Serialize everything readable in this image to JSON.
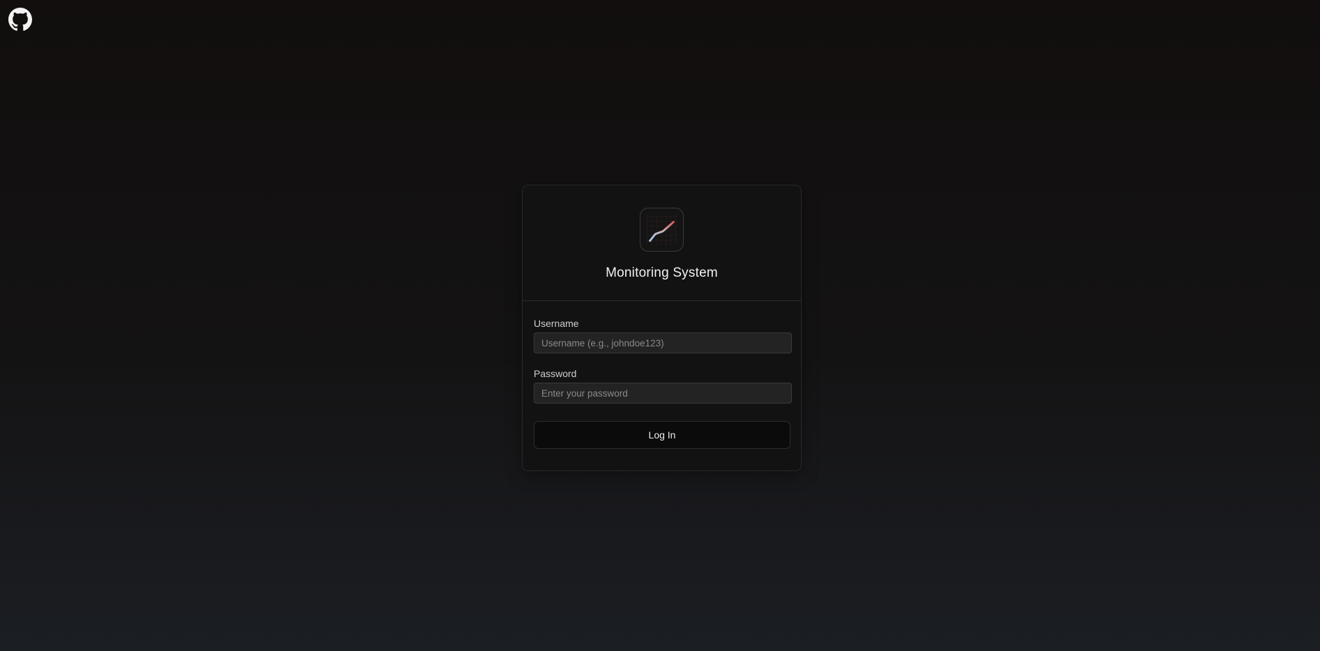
{
  "github": {
    "icon": "github-icon"
  },
  "card": {
    "logo_icon": "line-chart-icon",
    "title": "Monitoring System"
  },
  "form": {
    "username_label": "Username",
    "username_placeholder": "Username (e.g., johndoe123)",
    "username_value": "",
    "password_label": "Password",
    "password_placeholder": "Enter your password",
    "password_value": "",
    "submit_label": "Log In"
  },
  "colors": {
    "background_top": "#110e0d",
    "background_bottom": "#1b1e23",
    "card_bg": "#121212",
    "input_bg": "#232323",
    "button_bg": "#0b0b0b",
    "logo_line_start": "#a9c6e8",
    "logo_line_end": "#e0535a"
  }
}
